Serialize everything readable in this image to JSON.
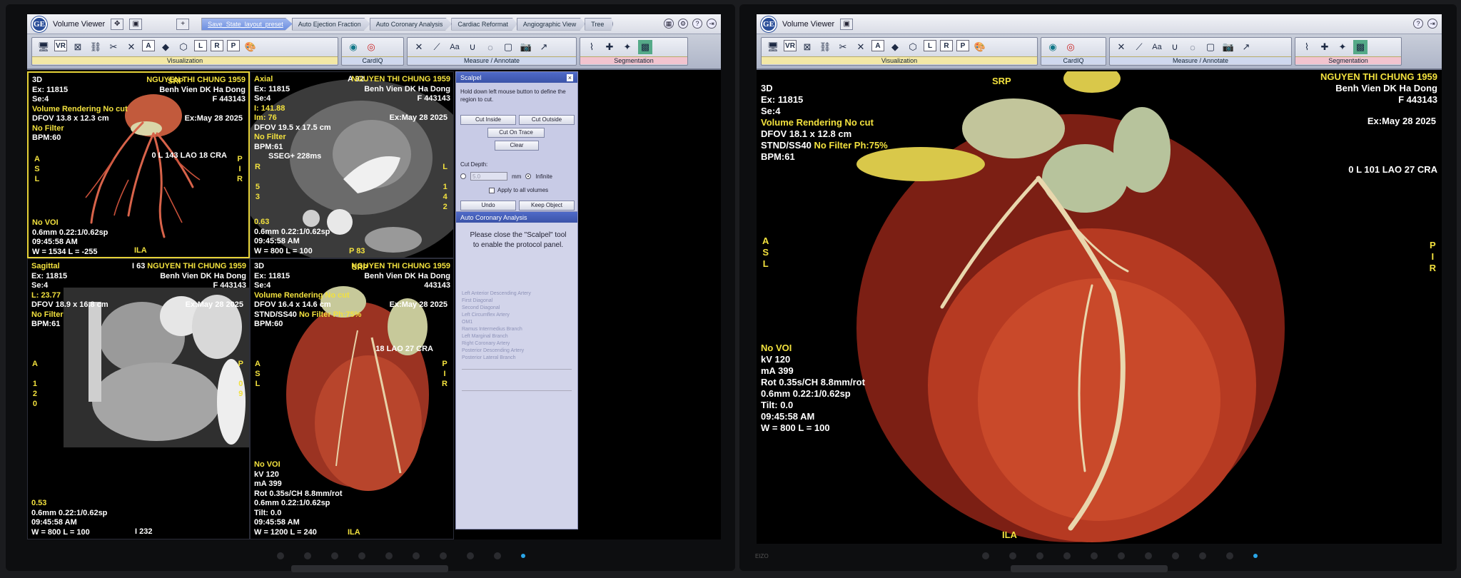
{
  "left": {
    "app_title": "Volume Viewer",
    "tabs": [
      "Save_State_layout_preset",
      "Auto Ejection Fraction",
      "Auto Coronary Analysis",
      "Cardiac Reformat",
      "Angiographic View",
      "Tree"
    ],
    "toolbar": {
      "visualization": "Visualization",
      "cardiq": "CardIQ",
      "measure": "Measure / Annotate",
      "segmentation": "Segmentation"
    },
    "vp3d": {
      "mode": "3D",
      "ex": "Ex: 11815",
      "se": "Se:4",
      "render": "Volume Rendering No cut",
      "dfov": "DFOV 13.8 x 12.3 cm",
      "filter": "No Filter",
      "bpm": "BPM:60",
      "patient": "NGUYEN THI CHUNG 1959",
      "hospital": "Benh Vien DK Ha Dong",
      "id": "F 443143",
      "date": "Ex:May 28 2025",
      "angle": "0 L 143 LAO 18 CRA",
      "voi": "No VOI",
      "slice": "0.6mm 0.22:1/0.62sp",
      "time": "09:45:58 AM",
      "wl": "W = 1534 L = -255",
      "top": "SRP",
      "bottom": "ILA",
      "left_orient": [
        "A",
        "S",
        "L"
      ],
      "right_orient": [
        "P",
        "I",
        "R"
      ]
    },
    "axial": {
      "mode": "Axial",
      "a": "A 92",
      "ex": "Ex: 11815",
      "se": "Se:4",
      "i": "I: 141.88",
      "im": "Im: 76",
      "dfov": "DFOV 19.5 x 17.5 cm",
      "filter": "No Filter",
      "bpm": "BPM:61",
      "sseg": "SSEG+ 228ms",
      "patient": "NGUYEN THI CHUNG 1959",
      "hospital": "Benh Vien DK Ha Dong",
      "id": "F 443143",
      "date": "Ex:May 28 2025",
      "thick": "0.63",
      "slice": "0.6mm 0.22:1/0.62sp",
      "time": "09:45:58 AM",
      "wl": "W = 800 L = 100",
      "p": "P 83",
      "r": "R",
      "l": "L",
      "left_nums": [
        "5",
        "3"
      ],
      "right_nums": [
        "1",
        "4",
        "2"
      ]
    },
    "sagittal": {
      "mode": "Sagittal",
      "i": "I 63",
      "ex": "Ex: 11815",
      "se": "Se:4",
      "l": "L: 23.77",
      "dfov": "DFOV 18.9 x 16.8 cm",
      "filter": "No Filter",
      "bpm": "BPM:61",
      "patient": "NGUYEN THI CHUNG 1959",
      "hospital": "Benh Vien DK Ha Dong",
      "id": "F 443143",
      "date": "Ex:May 28 2025",
      "thick": "0.53",
      "slice": "0.6mm 0.22:1/0.62sp",
      "time": "09:45:58 AM",
      "wl": "W = 800 L = 100",
      "bottom": "I 232",
      "left_orient": [
        "A",
        "1",
        "2",
        "0"
      ],
      "right_orient": [
        "P",
        "0",
        "9"
      ]
    },
    "vr2": {
      "mode": "3D",
      "ex": "Ex: 11815",
      "se": "Se:4",
      "render": "Volume Rendering No cut",
      "dfov": "DFOV 16.4 x 14.6 cm",
      "stnd": "STND/SS40",
      "filter": "No Filter Ph:75%",
      "bpm": "BPM:60",
      "top": "SRP",
      "patient": "NGUYEN THI CHUNG 1959",
      "hospital": "Benh Vien DK Ha Dong",
      "id": "443143",
      "date": "Ex:May 28 2025",
      "angle": "18 LAO 27 CRA",
      "voi": "No VOI",
      "kv": "kV 120",
      "ma": "mA 399",
      "rot": "Rot 0.35s/CH 8.8mm/rot",
      "slice": "0.6mm 0.22:1/0.62sp",
      "tilt": "Tilt: 0.0",
      "time": "09:45:58 AM",
      "wl": "W = 1200 L = 240",
      "bottom": "ILA",
      "left_orient": [
        "A",
        "S",
        "L"
      ],
      "right_orient": [
        "P",
        "I",
        "R"
      ]
    },
    "scalpel": {
      "title": "Scalpel",
      "hint": "Hold down left mouse button to define the region to cut.",
      "cut_inside": "Cut Inside",
      "cut_outside": "Cut Outside",
      "cut_on_trace": "Cut On Trace",
      "clear": "Clear",
      "cut_depth": "Cut Depth:",
      "depth_value": "5.0",
      "mm": "mm",
      "infinite": "Infinite",
      "apply_all": "Apply to all volumes",
      "undo": "Undo",
      "keep_object": "Keep Object"
    },
    "aca": {
      "title": "Auto Coronary Analysis",
      "message": "Please close the \"Scalpel\" tool to enable the protocol panel.",
      "faded_items": [
        "Left Anterior Descending Artery",
        "First Diagonal",
        "Second Diagonal",
        "Left Circumflex Artery",
        "OM1",
        "Ramus Intermedius Branch",
        "Left Marginal Branch",
        "Right Coronary Artery",
        "Posterior Descending Artery",
        "Posterior Lateral Branch"
      ]
    }
  },
  "right": {
    "app_title": "Volume Viewer",
    "toolbar": {
      "visualization": "Visualization",
      "cardiq": "CardIQ",
      "measure": "Measure / Annotate",
      "segmentation": "Segmentation"
    },
    "vp": {
      "mode": "3D",
      "ex": "Ex: 11815",
      "se": "Se:4",
      "render": "Volume Rendering No cut",
      "dfov": "DFOV 18.1 x 12.8 cm",
      "stnd": "STND/SS40",
      "filter": "No Filter Ph:75%",
      "bpm": "BPM:61",
      "top": "SRP",
      "patient": "NGUYEN THI CHUNG 1959",
      "hospital": "Benh Vien DK Ha Dong",
      "id": "F 443143",
      "date": "Ex:May 28 2025",
      "angle": "0 L 101 LAO 27 CRA",
      "voi": "No VOI",
      "kv": "kV 120",
      "ma": "mA 399",
      "rot": "Rot 0.35s/CH 8.8mm/rot",
      "slice": "0.6mm 0.22:1/0.62sp",
      "tilt": "Tilt: 0.0",
      "time": "09:45:58 AM",
      "wl": "W = 800 L = 100",
      "bottom": "ILA",
      "left_orient": [
        "A",
        "S",
        "L"
      ],
      "right_orient": [
        "P",
        "I",
        "R"
      ]
    },
    "brand": "EIZO"
  },
  "colors": {
    "overlay_yellow": "#f2e13e",
    "overlay_white": "#ffffff",
    "panel_bg": "#c8cbe6",
    "title_blue": "#3b53a8"
  },
  "icons": [
    "ge-logo",
    "cursor-icon",
    "layout-icon",
    "gear-icon",
    "help-icon",
    "close-icon",
    "scalpel-icon",
    "ruler-icon",
    "text-icon"
  ]
}
